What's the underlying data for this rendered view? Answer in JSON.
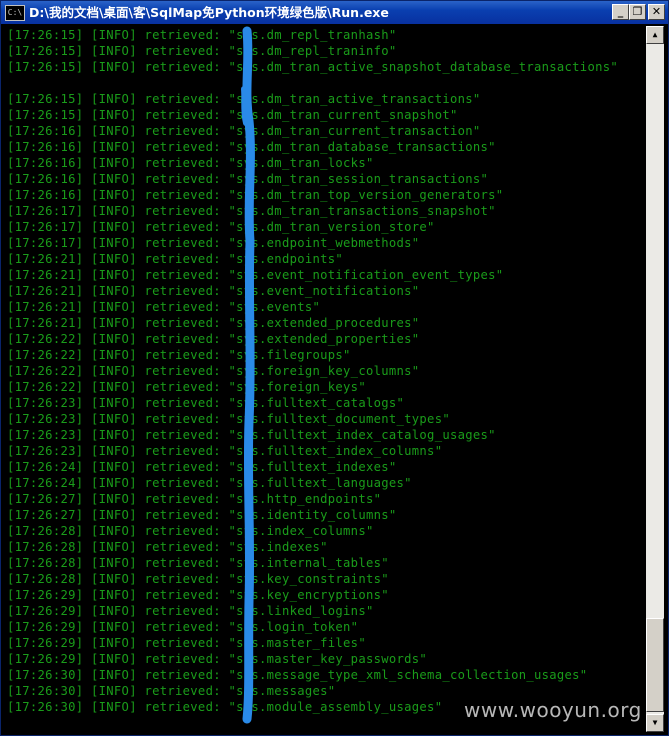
{
  "window": {
    "title": "D:\\我的文档\\桌面\\客\\SqlMap免Python环境绿色版\\Run.exe",
    "icon_text": "C:\\",
    "minimize_glyph": "_",
    "maximize_glyph": "❐",
    "close_glyph": "✕"
  },
  "console": {
    "lines": [
      "[17:26:15] [INFO] retrieved: \"sys.dm_repl_tranhash\"",
      "[17:26:15] [INFO] retrieved: \"sys.dm_repl_traninfo\"",
      "[17:26:15] [INFO] retrieved: \"sys.dm_tran_active_snapshot_database_transactions\"",
      "",
      "[17:26:15] [INFO] retrieved: \"sys.dm_tran_active_transactions\"",
      "[17:26:15] [INFO] retrieved: \"sys.dm_tran_current_snapshot\"",
      "[17:26:16] [INFO] retrieved: \"sys.dm_tran_current_transaction\"",
      "[17:26:16] [INFO] retrieved: \"sys.dm_tran_database_transactions\"",
      "[17:26:16] [INFO] retrieved: \"sys.dm_tran_locks\"",
      "[17:26:16] [INFO] retrieved: \"sys.dm_tran_session_transactions\"",
      "[17:26:16] [INFO] retrieved: \"sys.dm_tran_top_version_generators\"",
      "[17:26:17] [INFO] retrieved: \"sys.dm_tran_transactions_snapshot\"",
      "[17:26:17] [INFO] retrieved: \"sys.dm_tran_version_store\"",
      "[17:26:17] [INFO] retrieved: \"sys.endpoint_webmethods\"",
      "[17:26:21] [INFO] retrieved: \"sys.endpoints\"",
      "[17:26:21] [INFO] retrieved: \"sys.event_notification_event_types\"",
      "[17:26:21] [INFO] retrieved: \"sys.event_notifications\"",
      "[17:26:21] [INFO] retrieved: \"sys.events\"",
      "[17:26:21] [INFO] retrieved: \"sys.extended_procedures\"",
      "[17:26:22] [INFO] retrieved: \"sys.extended_properties\"",
      "[17:26:22] [INFO] retrieved: \"sys.filegroups\"",
      "[17:26:22] [INFO] retrieved: \"sys.foreign_key_columns\"",
      "[17:26:22] [INFO] retrieved: \"sys.foreign_keys\"",
      "[17:26:23] [INFO] retrieved: \"sys.fulltext_catalogs\"",
      "[17:26:23] [INFO] retrieved: \"sys.fulltext_document_types\"",
      "[17:26:23] [INFO] retrieved: \"sys.fulltext_index_catalog_usages\"",
      "[17:26:23] [INFO] retrieved: \"sys.fulltext_index_columns\"",
      "[17:26:24] [INFO] retrieved: \"sys.fulltext_indexes\"",
      "[17:26:24] [INFO] retrieved: \"sys.fulltext_languages\"",
      "[17:26:27] [INFO] retrieved: \"sys.http_endpoints\"",
      "[17:26:27] [INFO] retrieved: \"sys.identity_columns\"",
      "[17:26:28] [INFO] retrieved: \"sys.index_columns\"",
      "[17:26:28] [INFO] retrieved: \"sys.indexes\"",
      "[17:26:28] [INFO] retrieved: \"sys.internal_tables\"",
      "[17:26:28] [INFO] retrieved: \"sys.key_constraints\"",
      "[17:26:29] [INFO] retrieved: \"sys.key_encryptions\"",
      "[17:26:29] [INFO] retrieved: \"sys.linked_logins\"",
      "[17:26:29] [INFO] retrieved: \"sys.login_token\"",
      "[17:26:29] [INFO] retrieved: \"sys.master_files\"",
      "[17:26:29] [INFO] retrieved: \"sys.master_key_passwords\"",
      "[17:26:30] [INFO] retrieved: \"sys.message_type_xml_schema_collection_usages\"",
      "[17:26:30] [INFO] retrieved: \"sys.messages\"",
      "[17:26:30] [INFO] retrieved: \"sys.module_assembly_usages\""
    ],
    "text_color": "#1a9c1a",
    "background": "#000000"
  },
  "scrollbar": {
    "up_glyph": "▲",
    "down_glyph": "▼"
  },
  "annotation": {
    "color": "#2a8ae8"
  },
  "watermark": {
    "text": "www.wooyun.org"
  }
}
